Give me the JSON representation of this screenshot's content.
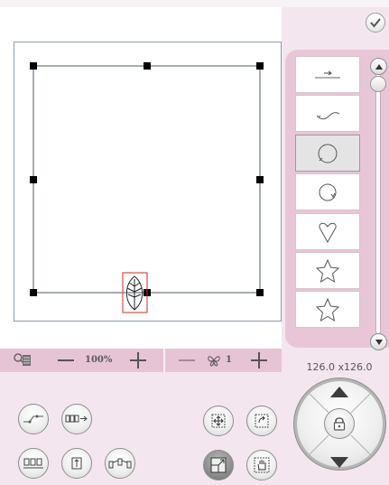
{
  "toolbar": {
    "confirm_icon": "checkmark-icon"
  },
  "zoom": {
    "label": "100%",
    "zoom_icon": "zoom-list-icon",
    "decrease_icon": "minus-icon",
    "increase_icon": "plus-icon"
  },
  "repeat": {
    "count": "1",
    "icon": "butterfly-icon",
    "decrease_icon": "minus-icon",
    "increase_icon": "plus-icon"
  },
  "dimensions": {
    "text": "126.0 x126.0"
  },
  "stitch_list": {
    "items": [
      {
        "icon": "straight-line-stitch-icon"
      },
      {
        "icon": "curve-line-stitch-icon"
      },
      {
        "icon": "circle-left-stitch-icon",
        "selected": true
      },
      {
        "icon": "circle-right-stitch-icon"
      },
      {
        "icon": "heart-stitch-icon"
      },
      {
        "icon": "star-stitch-icon"
      },
      {
        "icon": "star-outline-stitch-icon"
      }
    ]
  },
  "tools": {
    "left": [
      "corner-stitch-icon",
      "stitch-count-icon",
      "stitch-row-icon",
      "needle-position-icon",
      "mirror-stitch-icon"
    ],
    "center": [
      "move-icon",
      "rotate-icon",
      "resize-icon",
      "pan-hand-icon"
    ]
  },
  "joystick": {
    "lock_icon": "lock-icon"
  },
  "colors": {
    "background": "#f4e6ef",
    "panel": "#e8c6d8",
    "selection": "#cc2a2a",
    "handle": "#000000"
  }
}
